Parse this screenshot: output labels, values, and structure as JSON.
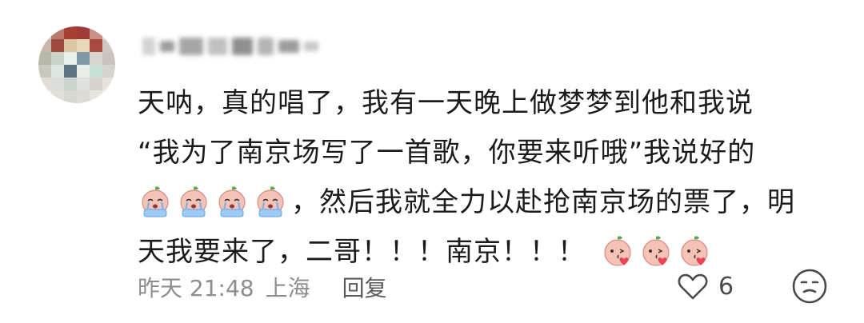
{
  "comment": {
    "lines": {
      "l1": "天呐，真的唱了，我有一天晚上做梦梦到他和我说",
      "l2": "“我为了南京场写了一首歌，你要来听哦”我说好的",
      "l3": "，然后我就全力以赴抢南京场的票了，明",
      "l4": "天我要来了，二哥！！！南京！！！"
    },
    "emojis": {
      "crying": "crying-peach-icon",
      "kiss": "kissing-peach-icon"
    },
    "time": "昨天 21:48",
    "location": "上海",
    "reply_label": "回复",
    "like_count": "6"
  },
  "colors": {
    "text": "#1b1b1b",
    "meta": "#8d8d8d",
    "peach": "#f5c2b8",
    "tears": "#7fb6e8",
    "heart": "#e8455a"
  }
}
